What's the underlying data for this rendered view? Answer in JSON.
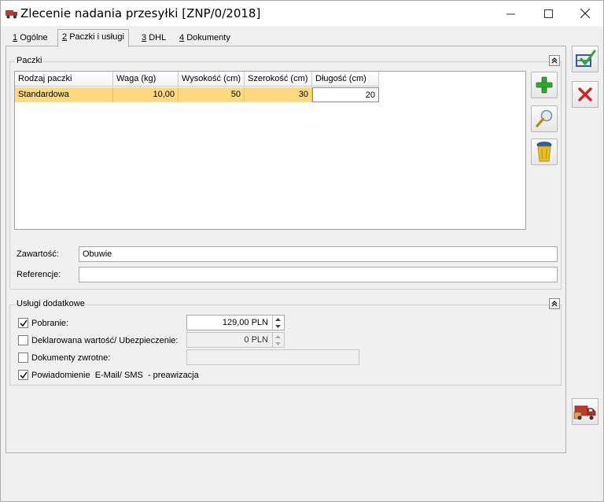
{
  "window": {
    "title": "Zlecenie nadania przesyłki [ZNP/0/2018]"
  },
  "tabs": [
    {
      "num": "1",
      "label": "Ogólne"
    },
    {
      "num": "2",
      "label": "Paczki i usługi"
    },
    {
      "num": "3",
      "label": "DHL"
    },
    {
      "num": "4",
      "label": "Dokumenty"
    }
  ],
  "paczki": {
    "group_title": "Paczki",
    "columns": [
      "Rodzaj paczki",
      "Waga (kg)",
      "Wysokość (cm)",
      "Szerokość (cm)",
      "Długość (cm)"
    ],
    "rows": [
      {
        "rodzaj": "Standardowa",
        "waga": "10,00",
        "wysokosc": "50",
        "szerokosc": "30",
        "dlugosc": "20"
      }
    ],
    "zawartosc_label": "Zawartość:",
    "zawartosc_value": "Obuwie",
    "referencje_label": "Referencje:",
    "referencje_value": ""
  },
  "uslugi": {
    "group_title": "Usługi dodatkowe",
    "pobranie": {
      "label": "Pobranie:",
      "checked": true,
      "value": "129,00 PLN"
    },
    "deklarowana": {
      "label": "Deklarowana wartość/ Ubezpieczenie:",
      "checked": false,
      "value": "0 PLN"
    },
    "dokumenty_zwrotne": {
      "label": "Dokumenty zwrotne:",
      "checked": false,
      "value": ""
    },
    "powiadomienie": {
      "label": "Powiadomienie  E-Mail/ SMS  - preawizacja",
      "checked": true
    }
  },
  "icons": {
    "app": "truck-icon",
    "save": "save-check-icon",
    "cancel": "red-x-icon",
    "add": "green-plus-icon",
    "preview": "magnifier-icon",
    "delete": "trash-bin-icon",
    "send": "delivery-truck-icon"
  },
  "colors": {
    "selected_row": "#ffd97e",
    "add": "#2fa82f",
    "cancel": "#d42020"
  }
}
